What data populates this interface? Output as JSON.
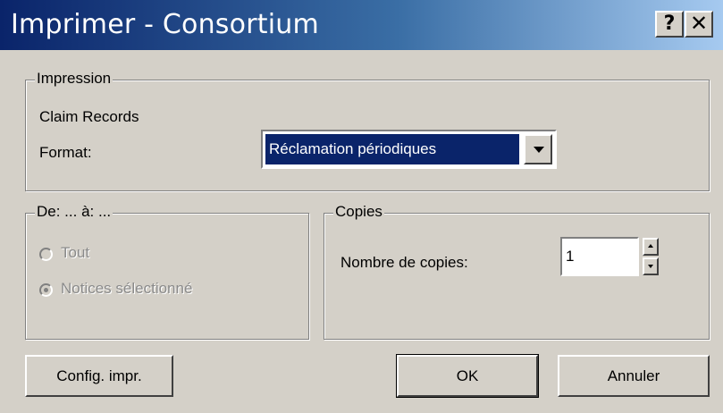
{
  "window": {
    "title": "Imprimer - Consortium",
    "help_glyph": "?",
    "close_glyph": "✕"
  },
  "impression": {
    "legend": "Impression",
    "item_text": "Claim Records",
    "format_label": "Format:",
    "format_value": "Réclamation périodiques"
  },
  "range": {
    "legend": "De: ... à: ...",
    "options": [
      {
        "label": "Tout",
        "selected": false,
        "enabled": false
      },
      {
        "label": "Notices sélectionné",
        "selected": true,
        "enabled": false
      }
    ]
  },
  "copies": {
    "legend": "Copies",
    "label": "Nombre de copies:",
    "value": "1"
  },
  "buttons": {
    "setup": "Config. impr.",
    "ok": "OK",
    "cancel": "Annuler"
  }
}
